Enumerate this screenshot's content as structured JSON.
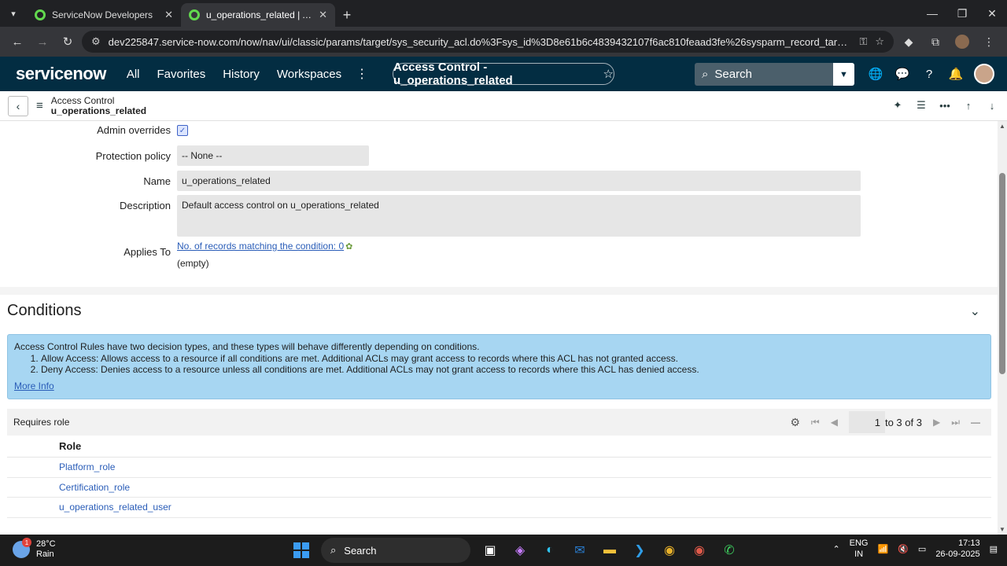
{
  "browser": {
    "tabs": [
      {
        "label": "ServiceNow Developers",
        "active": false
      },
      {
        "label": "u_operations_related | Access C",
        "active": true
      }
    ],
    "url": "dev225847.service-now.com/now/nav/ui/classic/params/target/sys_security_acl.do%3Fsys_id%3D8e61b6c4839432107f6ac810feaad3fe%26sysparm_record_target%3Dsys_security_acl..."
  },
  "sn_header": {
    "logo": "servicenow",
    "nav": [
      "All",
      "Favorites",
      "History",
      "Workspaces"
    ],
    "context_title": "Access Control - u_operations_related",
    "search_label": "Search"
  },
  "form_header": {
    "title": "Access Control",
    "subtitle": "u_operations_related"
  },
  "form": {
    "admin_overrides_label": "Admin overrides",
    "admin_overrides_checked": true,
    "protection_policy_label": "Protection policy",
    "protection_policy_value": "-- None --",
    "name_label": "Name",
    "name_value": "u_operations_related",
    "description_label": "Description",
    "description_value": "Default access control on u_operations_related",
    "applies_to_label": "Applies To",
    "applies_to_link": "No. of records matching the condition: 0",
    "applies_to_value": "(empty)"
  },
  "conditions": {
    "title": "Conditions",
    "info_intro": "Access Control Rules have two decision types, and these types will behave differently depending on conditions.",
    "info_items": [
      "Allow Access: Allows access to a resource if all conditions are met. Additional ACLs may grant access to records where this ACL has not granted access.",
      "Deny Access: Denies access to a resource unless all conditions are met. Additional ACLs may not grant access to records where this ACL has denied access."
    ],
    "more_info": "More Info"
  },
  "related_list": {
    "title": "Requires role",
    "page": "1",
    "page_range": "to 3 of 3",
    "column": "Role",
    "rows": [
      "Platform_role",
      "Certification_role",
      "u_operations_related_user"
    ]
  },
  "taskbar": {
    "weather_temp": "28°C",
    "weather_desc": "Rain",
    "weather_badge": "1",
    "search_label": "Search",
    "lang_line1": "ENG",
    "lang_line2": "IN",
    "time": "17:13",
    "date": "26-09-2025"
  }
}
